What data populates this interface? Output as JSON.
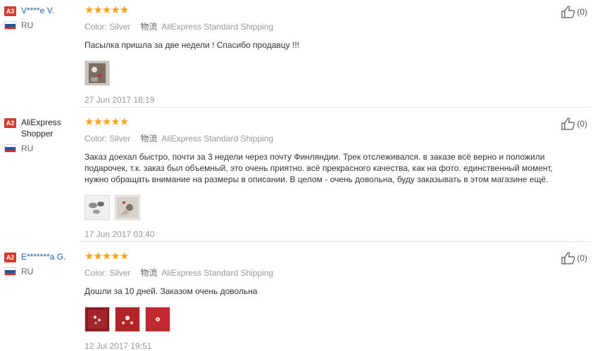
{
  "reviews": [
    {
      "level": "A3",
      "name": "V****e V.",
      "country": "RU",
      "rating": 5,
      "color_label": "Color:",
      "color_value": "Silver",
      "logistics_icon_text": "物流",
      "shipping": "AliExpress Standard Shipping",
      "text": "Пасылка пришла за две недели ! Спасибо продавцу !!!",
      "photos": [
        "photo-1"
      ],
      "date": "27 Jun 2017 18:19",
      "helpful_count": "(0)"
    },
    {
      "level": "A2",
      "name": "AliExpress Shopper",
      "country": "RU",
      "rating": 5,
      "color_label": "Color:",
      "color_value": "Silver",
      "logistics_icon_text": "物流",
      "shipping": "AliExpress Standard Shipping",
      "text_lines": [
        "Заказ доехал быстро, почти за 3 недели через почту Финляндии. Трек отслеживался. в заказе всё верно и положили",
        "подарочек, т.к. заказ был объемный, это очень приятно. всё прекрасного качества, как на фото. единственный момент,",
        "нужно обращать внимание на размеры в описании. В целом - очень довольна, буду заказывать в этом магазине ещё."
      ],
      "photos": [
        "photo-1",
        "photo-2"
      ],
      "date": "17 Jun 2017 03:40",
      "helpful_count": "(0)"
    },
    {
      "level": "A2",
      "name": "E*******a G.",
      "country": "RU",
      "rating": 5,
      "color_label": "Color:",
      "color_value": "Silver",
      "logistics_icon_text": "物流",
      "shipping": "AliExpress Standard Shipping",
      "text": "Дошли за 10 дней. Заказом очень довольна",
      "photos": [
        "photo-1",
        "photo-2",
        "photo-3"
      ],
      "date": "12 Jul 2017 19:51",
      "helpful_count": "(0)"
    }
  ],
  "icons": {
    "star": "star-icon",
    "thumb": "thumbs-up-icon",
    "flag": "russia-flag-icon"
  },
  "colors": {
    "badge": "#d9392c",
    "star": "#f7a21b",
    "link": "#1f5ea8",
    "meta": "#999999"
  }
}
